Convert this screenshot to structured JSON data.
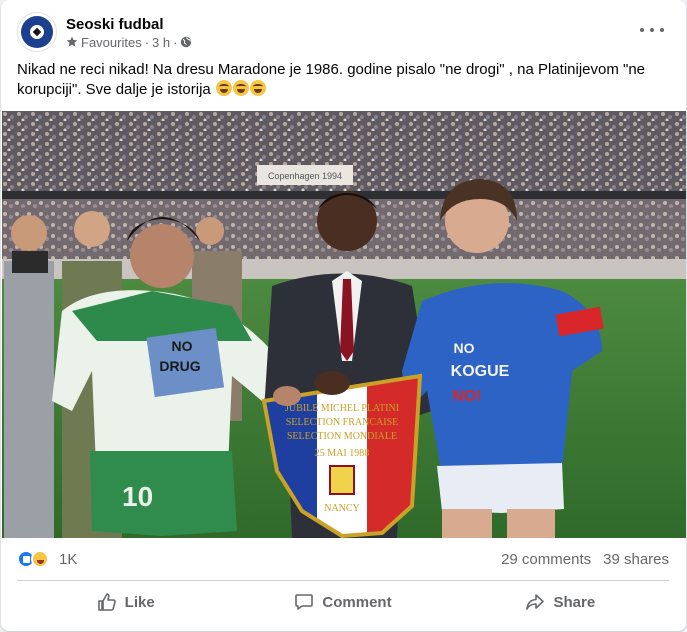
{
  "post": {
    "page_name": "Seoski fudbal",
    "audience": "Favourites",
    "separator": "·",
    "time": "3 h",
    "text": "Nikad ne reci nikad! Na dresu Maradone je 1986. godine pisalo \"ne drogi\" , na Platinijevom \"ne korupciji\". Sve dalje je istorija",
    "emoji_icon": "rolling-on-floor-laughing"
  },
  "photo": {
    "banner_lines": [
      "JUBILE MICHEL PLATINI",
      "SELECTION FRANCAISE",
      "SELECTION MONDIALE",
      "25 MAI 1988",
      "NANCY"
    ],
    "shirt_left_text": [
      "NO",
      "DRUG"
    ],
    "shirt_left_number": "10",
    "shirt_right_text": [
      "NO",
      "KOGUE",
      "NO!"
    ],
    "stand_banner": "Copenhagen 1994"
  },
  "stats": {
    "reaction_count": "1K",
    "comments": "29 comments",
    "shares": "39 shares"
  },
  "actions": {
    "like": "Like",
    "comment": "Comment",
    "share": "Share"
  },
  "colors": {
    "brand": "#1877f2",
    "secondary_text": "#65676b"
  }
}
